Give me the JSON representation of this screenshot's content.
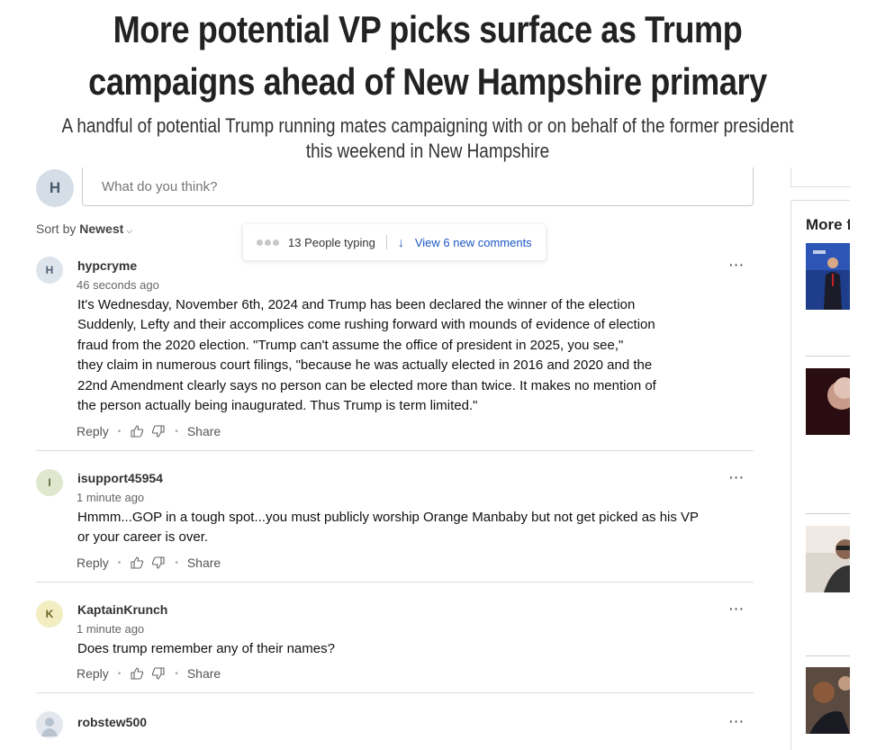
{
  "article": {
    "headline": "More potential VP picks surface as Trump campaigns ahead of New Hampshire primary",
    "subhead": "A handful of potential Trump running mates campaigning with or on behalf of the former president this weekend in New Hampshire"
  },
  "composer": {
    "avatar_letter": "H",
    "placeholder": "What do you think?"
  },
  "sort": {
    "prefix": "Sort by",
    "value": "Newest"
  },
  "typing": {
    "label": "13 People typing",
    "new_comments": "View 6 new comments"
  },
  "actions": {
    "reply": "Reply",
    "share": "Share",
    "more": "···"
  },
  "comments": [
    {
      "avatar_letter": "H",
      "username": "hypcryme",
      "time": "46 seconds ago",
      "lines": [
        "It's Wednesday, November 6th, 2024 and Trump has been declared the winner of the election",
        "Suddenly, Lefty and their accomplices come rushing forward with mounds of evidence of election",
        "fraud from the 2020 election.  \"Trump can't assume the office of president in 2025, you see,\"",
        "they claim in numerous court filings, \"because he was actually elected in 2016 and 2020 and the",
        "22nd Amendment clearly says no person can be elected more than twice. It makes no mention of",
        "the person actually being inaugurated. Thus Trump is term limited.\""
      ],
      "avatar_bg": "#dde4ec",
      "avatar_fg": "#4f6274"
    },
    {
      "avatar_letter": "I",
      "username": "isupport45954",
      "time": "1 minute ago",
      "lines": [
        "Hmmm...GOP in a tough spot...you must publicly worship Orange Manbaby but not get picked as his VP",
        "or your career is over."
      ],
      "avatar_bg": "#dfe8cf",
      "avatar_fg": "#5a6b3a"
    },
    {
      "avatar_letter": "K",
      "username": "KaptainKrunch",
      "time": "1 minute ago",
      "lines": [
        "Does trump remember any of their names?"
      ],
      "avatar_bg": "#f3eec2",
      "avatar_fg": "#6d6523"
    },
    {
      "username": "robstew500"
    }
  ],
  "rail": {
    "title": "More from"
  }
}
